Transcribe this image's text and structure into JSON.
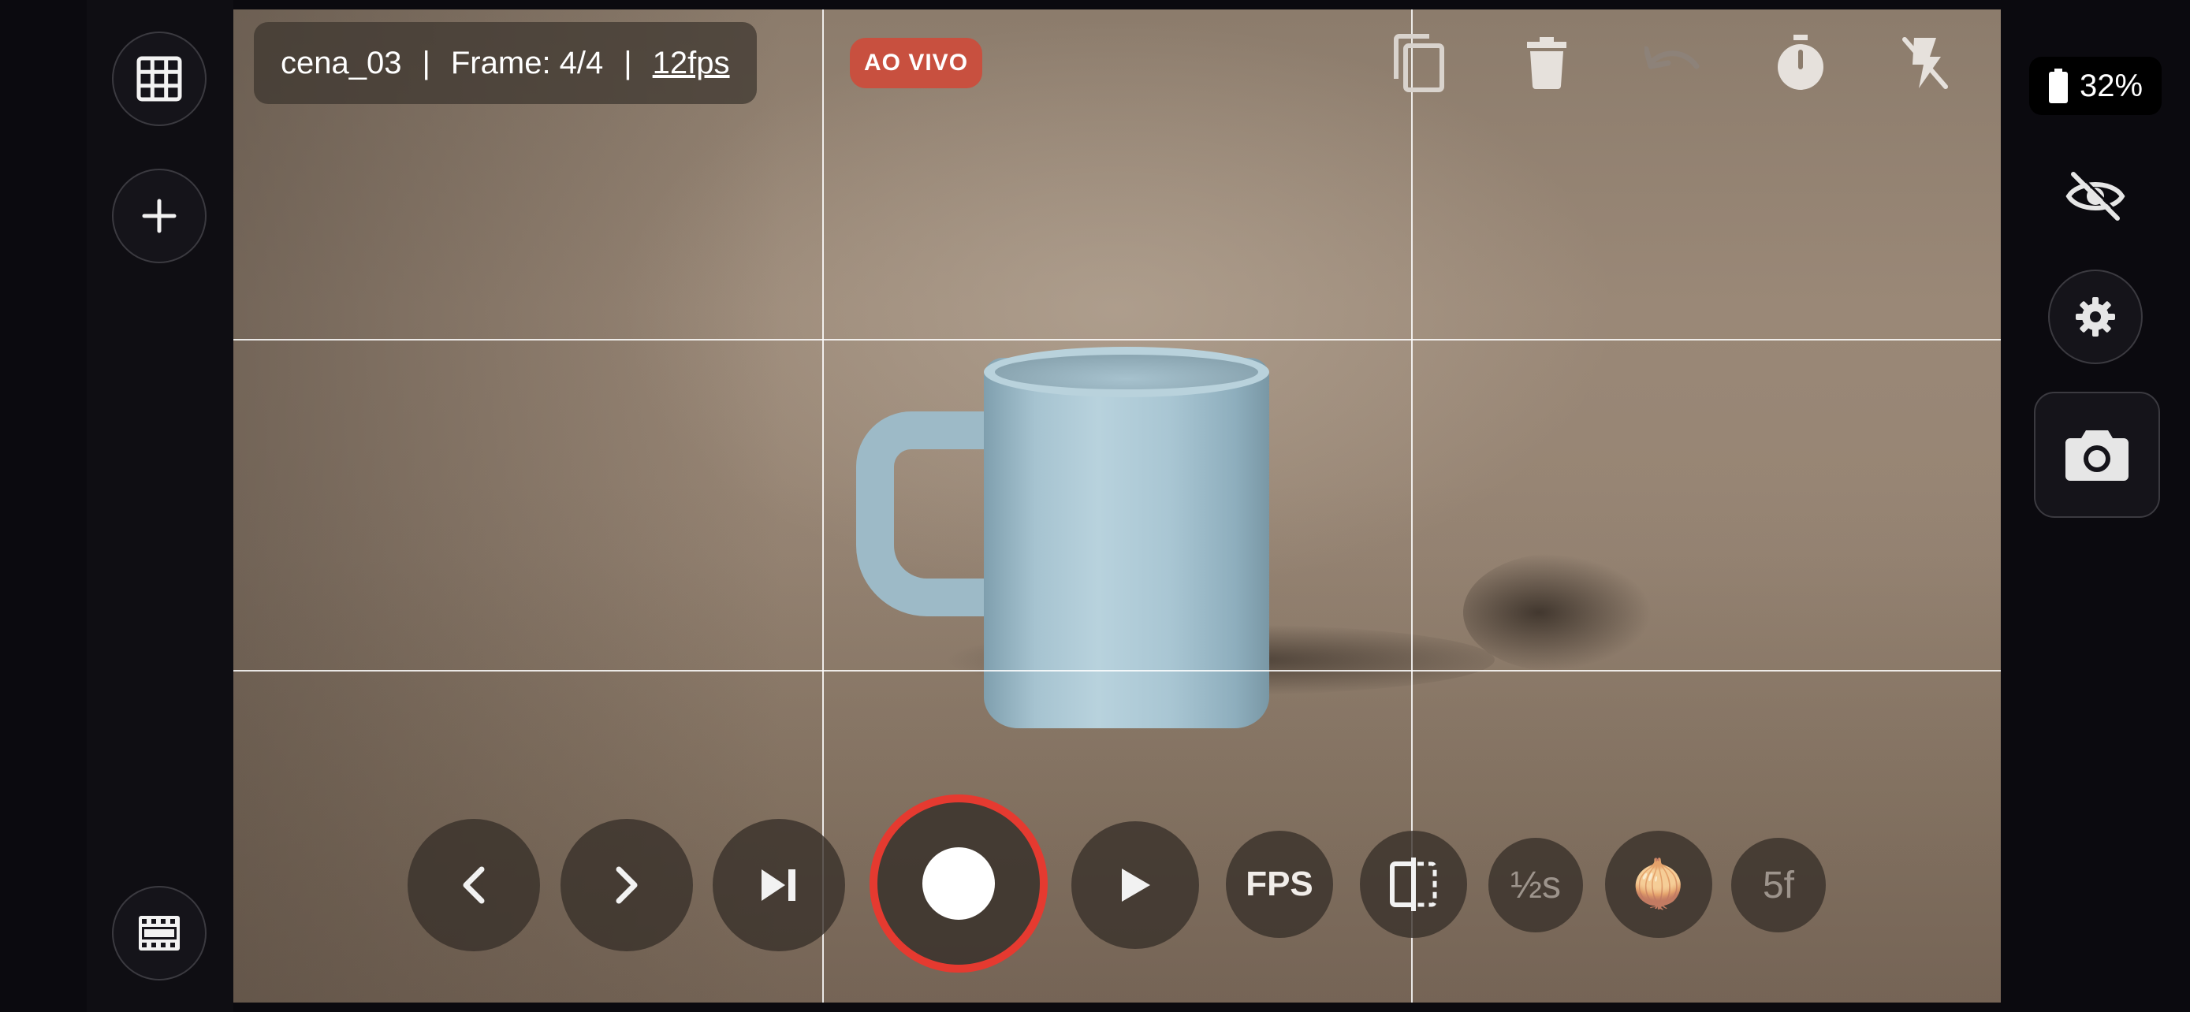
{
  "app": {
    "scene_name": "cena_03",
    "separator": "|",
    "frame_label": "Frame: 4/4",
    "fps_label": "12fps",
    "live_badge": "AO VIVO"
  },
  "sidebar_left": {
    "items": [
      {
        "name": "grid-view",
        "icon": "grid-icon"
      },
      {
        "name": "add",
        "icon": "plus-icon"
      },
      {
        "name": "filmstrip",
        "icon": "film-icon"
      }
    ]
  },
  "toolbar_top": {
    "items": [
      {
        "name": "duplicate",
        "icon": "copy-icon"
      },
      {
        "name": "delete",
        "icon": "trash-icon"
      },
      {
        "name": "undo",
        "icon": "undo-icon",
        "disabled": true
      },
      {
        "name": "timer",
        "icon": "timer-icon"
      },
      {
        "name": "flash-off",
        "icon": "flash-off-icon"
      }
    ]
  },
  "controls_bottom": {
    "fps_label": "FPS",
    "interval_label": "½s",
    "onion_emoji": "🧅",
    "frames_label": "5f",
    "items": [
      {
        "name": "previous-frame",
        "icon": "chevron-left-icon"
      },
      {
        "name": "next-frame",
        "icon": "chevron-right-icon"
      },
      {
        "name": "skip-to-live",
        "icon": "skip-next-icon"
      },
      {
        "name": "record",
        "icon": "record-icon"
      },
      {
        "name": "play",
        "icon": "play-icon"
      },
      {
        "name": "split-compare",
        "icon": "split-compare-icon"
      }
    ]
  },
  "sidebar_right": {
    "battery_percent": "32%",
    "items": [
      {
        "name": "hide-overlay",
        "icon": "eye-off-icon"
      },
      {
        "name": "settings",
        "icon": "gear-icon"
      },
      {
        "name": "capture",
        "icon": "camera-icon"
      }
    ]
  },
  "colors": {
    "background": "#0b0a0f",
    "record_ring": "#e53a30",
    "live_badge": "#c8503f",
    "control_fill": "#372f29"
  }
}
